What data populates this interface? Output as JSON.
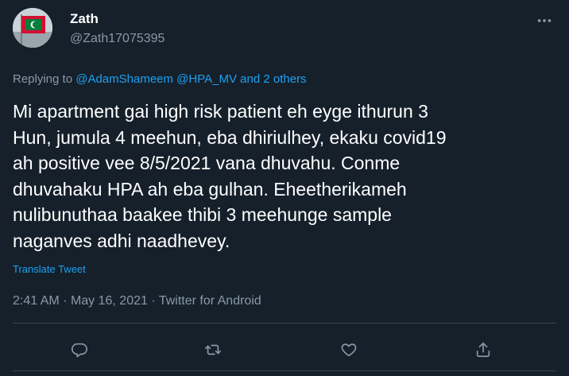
{
  "author": {
    "display_name": "Zath",
    "handle": "@Zath17075395",
    "avatar": "maldives-flag-avatar"
  },
  "replying": {
    "prefix": "Replying to",
    "mention_1": "@AdamShameem",
    "mention_2": "@HPA_MV",
    "and_text": "and",
    "others": "2 others"
  },
  "tweet": {
    "text": "Mi apartment gai high risk patient eh eyge ithurun 3\nHun, jumula 4 meehun, eba dhiriulhey, ekaku covid19\nah positive vee 8/5/2021 vana dhuvahu. Conme\ndhuvahaku HPA ah eba gulhan. Eheetherikameh\nnulibunuthaa baakee thibi 3 meehunge sample\nnaganves adhi naadhevey.",
    "translate_label": "Translate Tweet",
    "time": "2:41 AM",
    "date": "May 16, 2021",
    "source": "Twitter for Android",
    "separator": "·"
  },
  "actions": [
    "reply-icon",
    "retweet-icon",
    "like-icon",
    "share-icon"
  ],
  "colors": {
    "background": "#15202b",
    "link": "#1da1f2",
    "muted": "#8899a6",
    "divider": "#38444d"
  }
}
